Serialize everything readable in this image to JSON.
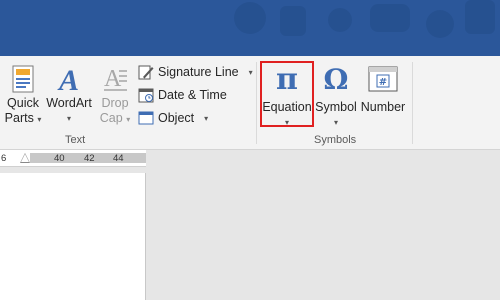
{
  "ribbon": {
    "text_group": {
      "label": "Text",
      "quick_parts": {
        "line1": "Quick",
        "line2": "Parts",
        "icon": "quick-parts-icon"
      },
      "wordart": {
        "label": "WordArt",
        "icon": "wordart-icon"
      },
      "drop_cap": {
        "line1": "Drop",
        "line2": "Cap",
        "icon": "drop-cap-icon"
      },
      "signature_line": {
        "label": "Signature Line",
        "icon": "signature-line-icon"
      },
      "date_time": {
        "label": "Date & Time",
        "icon": "calendar-icon"
      },
      "object": {
        "label": "Object",
        "icon": "object-icon"
      }
    },
    "symbols_group": {
      "label": "Symbols",
      "equation": {
        "label": "Equation",
        "glyph": "π",
        "icon": "pi-icon"
      },
      "symbol": {
        "label": "Symbol",
        "glyph": "Ω",
        "icon": "omega-icon"
      },
      "number": {
        "label": "Number",
        "glyph": "#",
        "icon": "number-icon"
      }
    },
    "caret": "▾"
  },
  "ruler": {
    "ticks": [
      "6",
      "40",
      "42",
      "44"
    ]
  },
  "colors": {
    "title_bar": "#2b579a",
    "accent": "#2b579a",
    "highlight": "#e02020"
  }
}
